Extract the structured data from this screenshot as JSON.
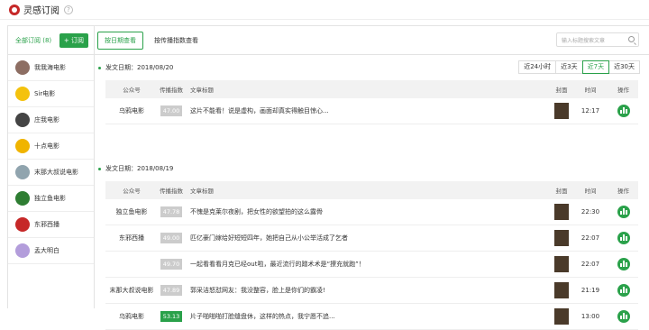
{
  "header": {
    "title": "灵感订阅",
    "help": "?"
  },
  "sidebar": {
    "all_label": "全部订阅 (8)",
    "subscribe_label": "+ 订阅",
    "items": [
      {
        "label": "我我海电影",
        "color": "#8d6e63"
      },
      {
        "label": "Sir电影",
        "color": "#f4c20d"
      },
      {
        "label": "庄我电影",
        "color": "#444444"
      },
      {
        "label": "十点电影",
        "color": "#f0b400"
      },
      {
        "label": "末那大叔说电影",
        "color": "#90a4ae"
      },
      {
        "label": "独立鱼电影",
        "color": "#2e7d32"
      },
      {
        "label": "东邪西播",
        "color": "#c62828"
      },
      {
        "label": "孟大明白",
        "color": "#b39ddb"
      }
    ]
  },
  "toolbar": {
    "by_date": "按日期查看",
    "by_index": "按传播指数查看",
    "search_placeholder": "输入标题搜索文章"
  },
  "ranges": [
    "近24小时",
    "近3天",
    "近7天",
    "近30天"
  ],
  "active_range": "近7天",
  "columns": {
    "account": "公众号",
    "index": "传播指数",
    "title": "文章标题",
    "cover": "封面",
    "time": "时间",
    "op": "操作"
  },
  "groups": [
    {
      "date": "发文日期：2018/08/20",
      "rows": [
        {
          "account": "乌鸦电影",
          "index": "47.00",
          "title": "这片不能看！说是虚构，画面却真实得触目惊心...",
          "time": "12:17",
          "green": false
        }
      ]
    },
    {
      "date": "发文日期：2018/08/19",
      "rows": [
        {
          "account": "独立鱼电影",
          "index": "47.78",
          "title": "不愧是克莱尔夜剧，把女性的欲望拍的这么露骨",
          "time": "22:30",
          "green": false
        },
        {
          "account": "东邪西播",
          "index": "49.00",
          "title": "匹亿豪门嫁给好短短四年，她把自己从小公举活成了乞者",
          "time": "22:07",
          "green": false
        },
        {
          "account": "",
          "index": "49.70",
          "title": "一起看看看月克已经out啦，最近流行的蹭术术是“撩充就跑”！",
          "time": "22:07",
          "green": false
        },
        {
          "account": "末那大叔说电影",
          "index": "47.89",
          "title": "郭采洁怒怼网友：我没整容，脸上是你们的霸凌!",
          "time": "21:19",
          "green": false
        },
        {
          "account": "乌鸦电影",
          "index": "53.13",
          "title": "片子啪啪啪打脸缝盘休，这样的热点，我宁愿不追...",
          "time": "13:00",
          "green": true
        }
      ]
    }
  ]
}
